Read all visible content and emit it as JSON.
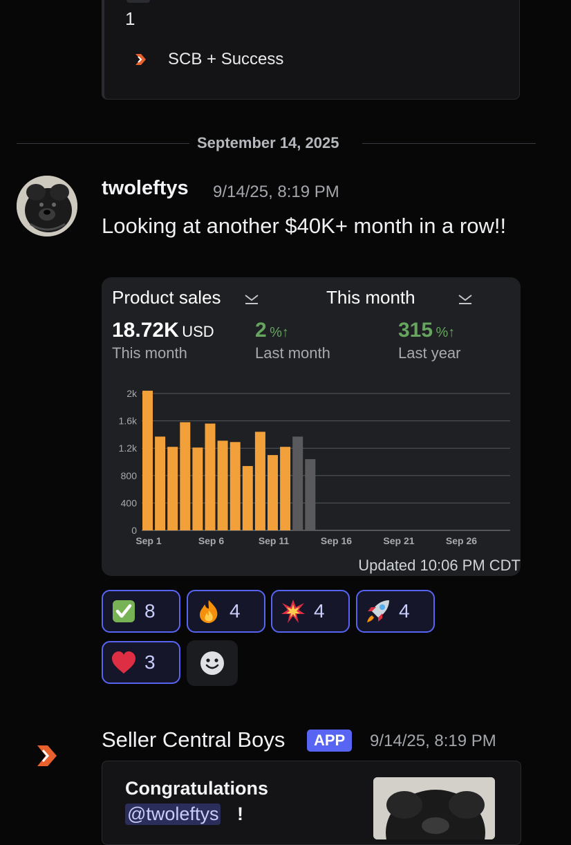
{
  "previous_embed": {
    "number_line": "1",
    "link_text": "SCB + Success",
    "link_icon": "chevron-logo-icon"
  },
  "date_divider": "September 14, 2025",
  "message": {
    "author": "twoleftys",
    "timestamp": "9/14/25, 8:19 PM",
    "text": "Looking at another $40K+ month in a row!!",
    "avatar_icon": "dog-avatar-icon"
  },
  "sales_card": {
    "metric_select": "Product sales",
    "period_select": "This month",
    "total_value": "18.72K",
    "total_unit": "USD",
    "total_label": "This month",
    "last_month_value": "2",
    "last_month_unit": "%↑",
    "last_month_label": "Last month",
    "last_year_value": "315",
    "last_year_unit": "%↑",
    "last_year_label": "Last year",
    "updated": "Updated 10:06 PM CDT",
    "colors": {
      "actual": "#f2a03a",
      "projected": "#5a5a5c",
      "positive": "#66a45f"
    }
  },
  "chart_data": {
    "type": "bar",
    "title": "",
    "xlabel": "",
    "ylabel": "",
    "ylim": [
      0,
      2000
    ],
    "y_ticks": [
      "0",
      "400",
      "800",
      "1.2k",
      "1.6k",
      "2k"
    ],
    "x_ticks": [
      "Sep 1",
      "Sep 6",
      "Sep 11",
      "Sep 16",
      "Sep 21",
      "Sep 26"
    ],
    "categories": [
      "Sep 1",
      "Sep 2",
      "Sep 3",
      "Sep 4",
      "Sep 5",
      "Sep 6",
      "Sep 7",
      "Sep 8",
      "Sep 9",
      "Sep 10",
      "Sep 11",
      "Sep 12",
      "Sep 13",
      "Sep 14"
    ],
    "series": [
      {
        "values": [
          2040,
          1370,
          1220,
          1580,
          1210,
          1560,
          1310,
          1290,
          940,
          1440,
          1100,
          1220,
          null,
          null
        ]
      },
      {
        "values": [
          null,
          null,
          null,
          null,
          null,
          null,
          null,
          null,
          null,
          null,
          null,
          null,
          1370,
          1040
        ]
      }
    ],
    "grid": true
  },
  "reactions": [
    {
      "icon": "check-mark-icon",
      "count": "8"
    },
    {
      "icon": "fire-icon",
      "count": "4"
    },
    {
      "icon": "collision-icon",
      "count": "4"
    },
    {
      "icon": "rocket-icon",
      "count": "4"
    },
    {
      "icon": "heart-icon",
      "count": "3"
    }
  ],
  "add_reaction_icon": "smiley-add-reaction-icon",
  "bot_message": {
    "author": "Seller Central Boys",
    "badge": "APP",
    "timestamp": "9/14/25, 8:19 PM",
    "embed_title": "Congratulations",
    "mention": "@twoleftys",
    "mention_suffix": "!"
  }
}
